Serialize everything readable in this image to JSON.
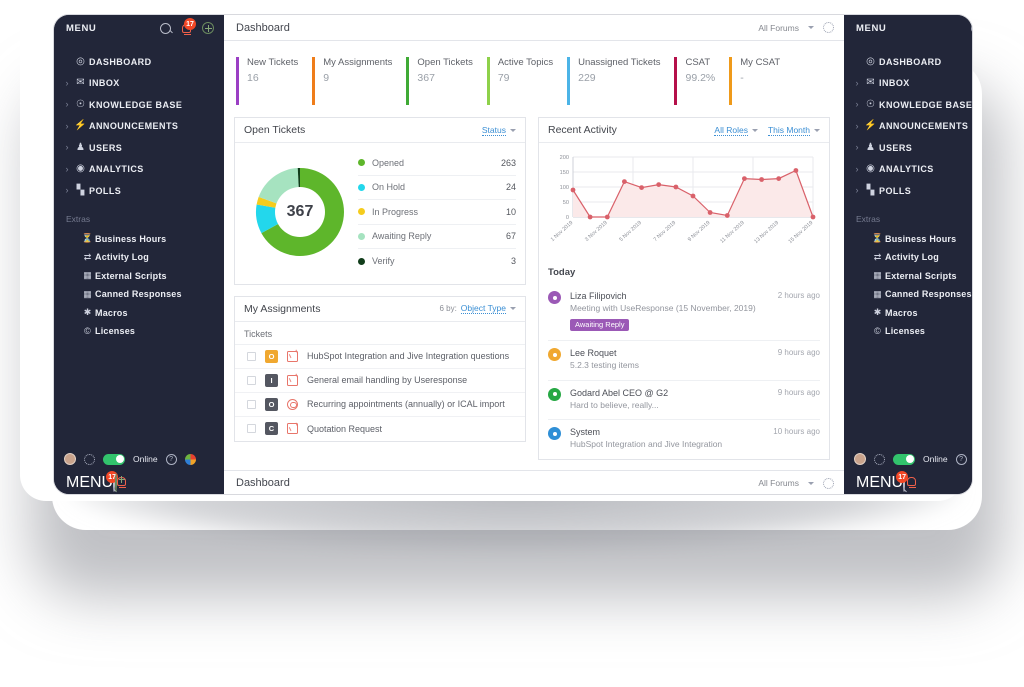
{
  "sidebar": {
    "menu_label": "MENU",
    "notification_count": "17",
    "search_icon": "search-icon",
    "bell_icon": "bell-icon",
    "add_icon": "plus-circle-icon",
    "items": [
      {
        "label": "DASHBOARD",
        "icon": "compass-icon",
        "expandable": false
      },
      {
        "label": "INBOX",
        "icon": "inbox-icon",
        "expandable": true
      },
      {
        "label": "KNOWLEDGE BASE",
        "icon": "lightbulb-icon",
        "expandable": true
      },
      {
        "label": "ANNOUNCEMENTS",
        "icon": "bolt-icon",
        "expandable": true
      },
      {
        "label": "USERS",
        "icon": "users-icon",
        "expandable": true
      },
      {
        "label": "ANALYTICS",
        "icon": "analytics-icon",
        "expandable": true
      },
      {
        "label": "POLLS",
        "icon": "bar-chart-icon",
        "expandable": true
      }
    ],
    "extras_label": "Extras",
    "extras": [
      {
        "label": "Business Hours",
        "icon": "clock-icon"
      },
      {
        "label": "Activity Log",
        "icon": "activity-icon"
      },
      {
        "label": "External Scripts",
        "icon": "script-icon"
      },
      {
        "label": "Canned Responses",
        "icon": "grid-icon"
      },
      {
        "label": "Macros",
        "icon": "macros-icon"
      },
      {
        "label": "Licenses",
        "icon": "copyright-icon"
      }
    ],
    "footer": {
      "avatar": "avatar",
      "gear_icon": "gear-icon",
      "status_label": "Online",
      "help_icon": "help-icon",
      "apps_icon": "apps-icon"
    }
  },
  "topbar": {
    "title": "Dashboard",
    "forums_label": "All Forums",
    "caret_icon": "chevron-down-icon",
    "settings_icon": "gear-icon"
  },
  "stats": [
    {
      "label": "New Tickets",
      "value": "16",
      "color": "#9b3fc4"
    },
    {
      "label": "My Assignments",
      "value": "9",
      "color": "#ef7d1a"
    },
    {
      "label": "Open Tickets",
      "value": "367",
      "color": "#3faa35"
    },
    {
      "label": "Active Topics",
      "value": "79",
      "color": "#8ed14a"
    },
    {
      "label": "Unassigned Tickets",
      "value": "229",
      "color": "#4cb4e7"
    },
    {
      "label": "CSAT",
      "value": "99.2%",
      "color": "#b5104a"
    },
    {
      "label": "My CSAT",
      "value": "-",
      "color": "#ef9a1a"
    }
  ],
  "open_tickets": {
    "title": "Open Tickets",
    "filter_label": "Status",
    "caret_icon": "chevron-down-icon",
    "total": "367"
  },
  "my_assignments": {
    "title": "My Assignments",
    "sort_prefix": "6 by:",
    "sort_value": "Object Type",
    "caret_icon": "chevron-down-icon",
    "section_label": "Tickets",
    "rows": [
      {
        "badge": "O",
        "badge_color": "#f0a830",
        "type_icon": "envelope-icon",
        "text": "HubSpot Integration and Jive Integration questions"
      },
      {
        "badge": "I",
        "badge_color": "#545761",
        "type_icon": "envelope-icon",
        "text": "General email handling by Useresponse"
      },
      {
        "badge": "O",
        "badge_color": "#545761",
        "type_icon": "lifebuoy-icon",
        "text": "Recurring appointments (annually) or ICAL import"
      },
      {
        "badge": "C",
        "badge_color": "#545761",
        "type_icon": "envelope-icon",
        "text": "Quotation Request"
      }
    ]
  },
  "recent_activity": {
    "title": "Recent Activity",
    "roles_label": "All Roles",
    "period_label": "This Month",
    "caret_icon": "chevron-down-icon",
    "today_label": "Today",
    "items": [
      {
        "name": "Liza Filipovich",
        "desc": "Meeting with UseResponse (15 November, 2019)",
        "time": "2 hours ago",
        "tag": "Awaiting Reply",
        "icon": "target-icon",
        "color": "#9b59b6"
      },
      {
        "name": "Lee Roquet",
        "desc": "5.2.3 testing items",
        "time": "9 hours ago",
        "tag": "",
        "icon": "comment-icon",
        "color": "#f0a830"
      },
      {
        "name": "Godard Abel CEO @ G2",
        "desc": "Hard to believe, really...",
        "time": "9 hours ago",
        "tag": "",
        "icon": "plus-circle-icon",
        "color": "#27a844"
      },
      {
        "name": "System",
        "desc": "HubSpot Integration and Jive Integration",
        "time": "10 hours ago",
        "tag": "",
        "icon": "gear-circle-icon",
        "color": "#2f8fd6"
      }
    ]
  },
  "chart_data": [
    {
      "type": "pie",
      "title": "Open Tickets",
      "center_label": "367",
      "labels": [
        "Opened",
        "On Hold",
        "In Progress",
        "Awaiting Reply",
        "Verify"
      ],
      "values": [
        263,
        24,
        10,
        67,
        3
      ],
      "colors": [
        "#5eb62b",
        "#23d7ec",
        "#f5cc1d",
        "#a6e3c0",
        "#113d1a"
      ],
      "legend": "right"
    },
    {
      "type": "area",
      "title": "Recent Activity",
      "xlabel": "",
      "ylabel": "",
      "ylim": [
        0,
        200
      ],
      "yticks": [
        0,
        50,
        100,
        150,
        200
      ],
      "grid": true,
      "line_color": "#d9616a",
      "fill_color": "#fbe9e9",
      "x": [
        "1 Nov 2019",
        "2 Nov 2019",
        "3 Nov 2019",
        "4 Nov 2019",
        "5 Nov 2019",
        "6 Nov 2019",
        "7 Nov 2019",
        "8 Nov 2019",
        "9 Nov 2019",
        "10 Nov 2019",
        "11 Nov 2019",
        "12 Nov 2019",
        "13 Nov 2019",
        "14 Nov 2019",
        "15 Nov 2019"
      ],
      "xtick_labels": [
        "1 Nov 2019",
        "3 Nov 2019",
        "5 Nov 2019",
        "7 Nov 2019",
        "9 Nov 2019",
        "11 Nov 2019",
        "13 Nov 2019",
        "15 Nov 2019"
      ],
      "values": [
        90,
        0,
        0,
        118,
        98,
        108,
        100,
        70,
        15,
        5,
        128,
        125,
        128,
        155,
        0
      ]
    }
  ]
}
